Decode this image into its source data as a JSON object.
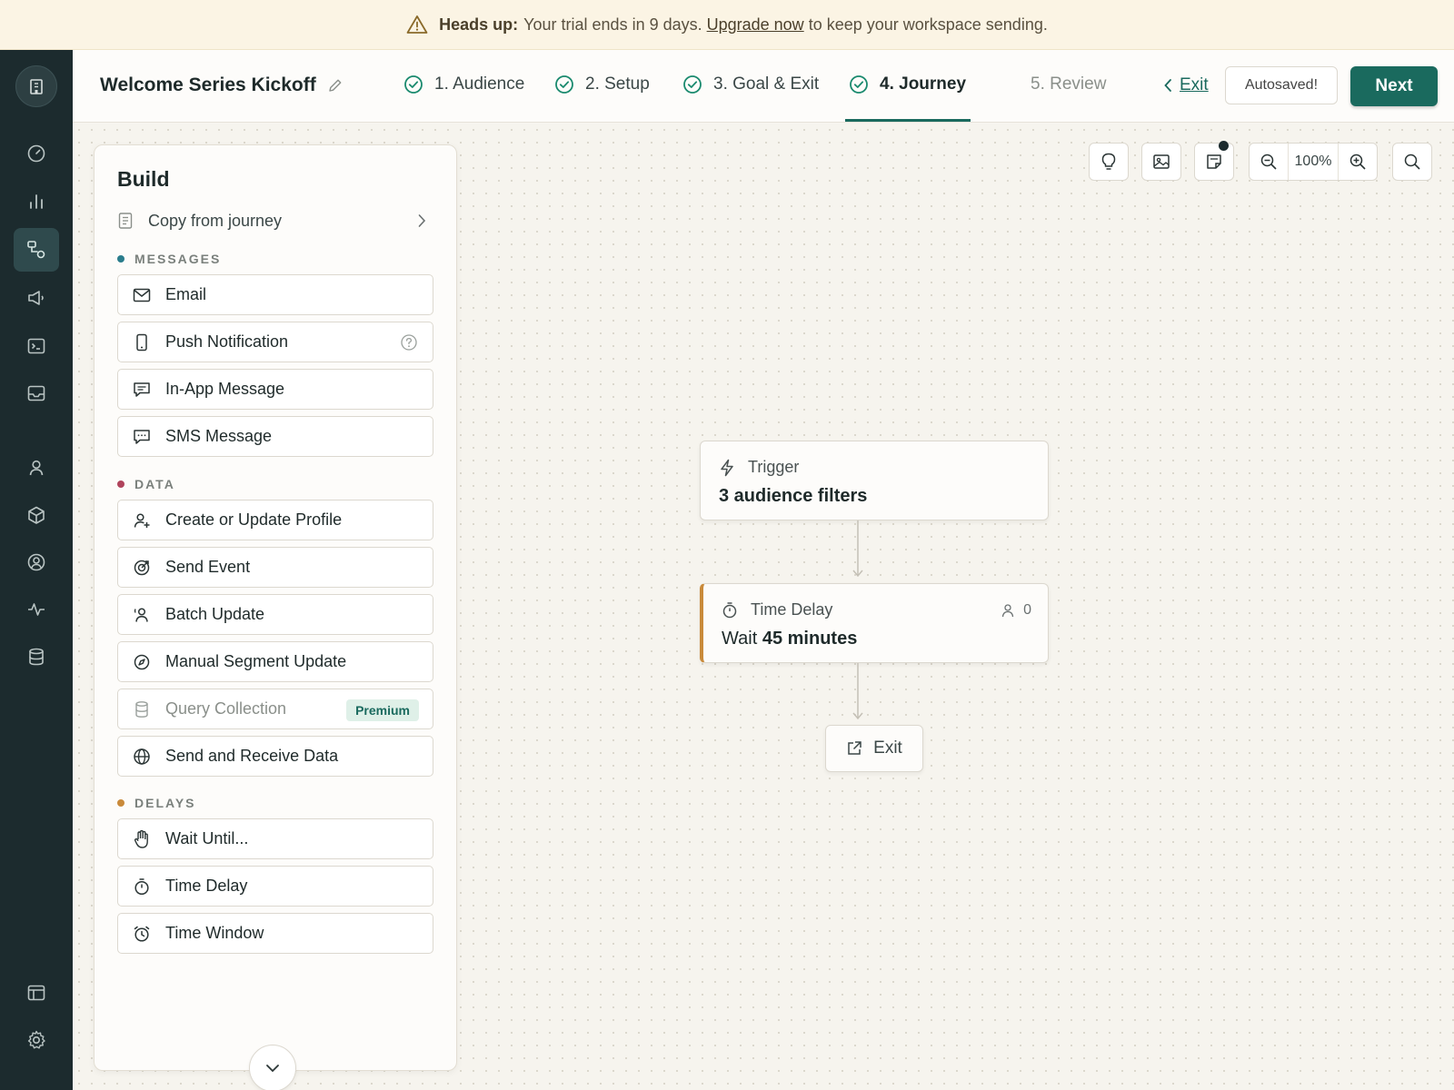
{
  "banner": {
    "icon": "warning-triangle-icon",
    "heading": "Heads up:",
    "text_before": "Your trial ends in 9 days.",
    "link": "Upgrade now",
    "text_after": "to keep your workspace sending."
  },
  "rail": {
    "items": [
      {
        "icon": "dashboard-icon"
      },
      {
        "icon": "analytics-icon"
      },
      {
        "icon": "journeys-icon",
        "active": true
      },
      {
        "icon": "campaigns-icon"
      },
      {
        "icon": "terminal-icon"
      },
      {
        "icon": "inbox-icon"
      },
      {
        "icon": "person-icon"
      },
      {
        "icon": "objects-icon"
      },
      {
        "icon": "profile-circle-icon"
      },
      {
        "icon": "activity-icon"
      },
      {
        "icon": "database-icon"
      },
      {
        "icon": "layout-icon"
      },
      {
        "icon": "settings-gear-icon"
      }
    ]
  },
  "header": {
    "title": "Welcome Series Kickoff",
    "steps": [
      {
        "label": "1. Audience",
        "state": "done"
      },
      {
        "label": "2. Setup",
        "state": "done"
      },
      {
        "label": "3. Goal & Exit",
        "state": "done"
      },
      {
        "label": "4. Journey",
        "state": "current"
      },
      {
        "label": "5. Review",
        "state": "pending"
      }
    ],
    "exit_label": "Exit",
    "autosave_label": "Autosaved!",
    "next_label": "Next"
  },
  "build": {
    "title": "Build",
    "copy_label": "Copy from journey",
    "sections": {
      "messages": {
        "label": "MESSAGES",
        "color": "#2a7d8c",
        "items": [
          "Email",
          "Push Notification",
          "In-App Message",
          "SMS Message"
        ]
      },
      "data": {
        "label": "DATA",
        "color": "#b0445c",
        "items": [
          "Create or Update Profile",
          "Send Event",
          "Batch Update",
          "Manual Segment Update",
          "Query Collection",
          "Send and Receive Data"
        ]
      },
      "delays": {
        "label": "DELAYS",
        "color": "#c98a3a",
        "items": [
          "Wait Until...",
          "Time Delay",
          "Time Window"
        ]
      }
    },
    "premium_label": "Premium"
  },
  "toolbar": {
    "zoom": "100%"
  },
  "flow": {
    "trigger": {
      "label": "Trigger",
      "summary": "3 audience filters"
    },
    "delay": {
      "label": "Time Delay",
      "prefix": "Wait",
      "value": "45 minutes",
      "count": "0"
    },
    "exit": {
      "label": "Exit"
    }
  },
  "colors": {
    "brand": "#1a6a5e",
    "rail_bg": "#1c2b2e",
    "delay_accent": "#c98a3a"
  }
}
